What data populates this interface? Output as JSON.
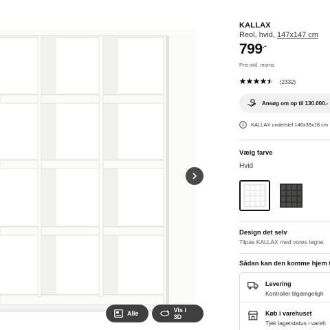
{
  "gallery": {
    "buttons": {
      "all_label": "Alle",
      "view3d_label": "Vis i 3D"
    }
  },
  "product": {
    "name": "KALLAX",
    "description": "Reol, hvid, ",
    "dimensions": "147x147 cm",
    "price_main": "799",
    "price_suffix": ".-",
    "vat_note": "Pris inkl. moms",
    "rating_value": 4.5,
    "rating_count": "(2332)"
  },
  "finance": {
    "label": "Ansøg om op til 130.000.- i"
  },
  "info": {
    "text": "KALLAX understel 146x39x18 cm"
  },
  "color": {
    "title": "Vælg farve",
    "selected": "Hvid",
    "options": [
      {
        "name": "white",
        "color": "#ffffff"
      },
      {
        "name": "black",
        "color": "#2e2e2e"
      }
    ]
  },
  "design": {
    "title": "Design det selv",
    "subtitle": "Tilpas KALLAX med vores tegne"
  },
  "delivery": {
    "title": "Sådan kan den komme hjem t",
    "items": [
      {
        "title": "Levering",
        "subtitle": "Kontroller tilgængeligh"
      },
      {
        "title": "Køb i varehuset",
        "subtitle": "Tjek lagerstatus i vareh"
      }
    ]
  }
}
